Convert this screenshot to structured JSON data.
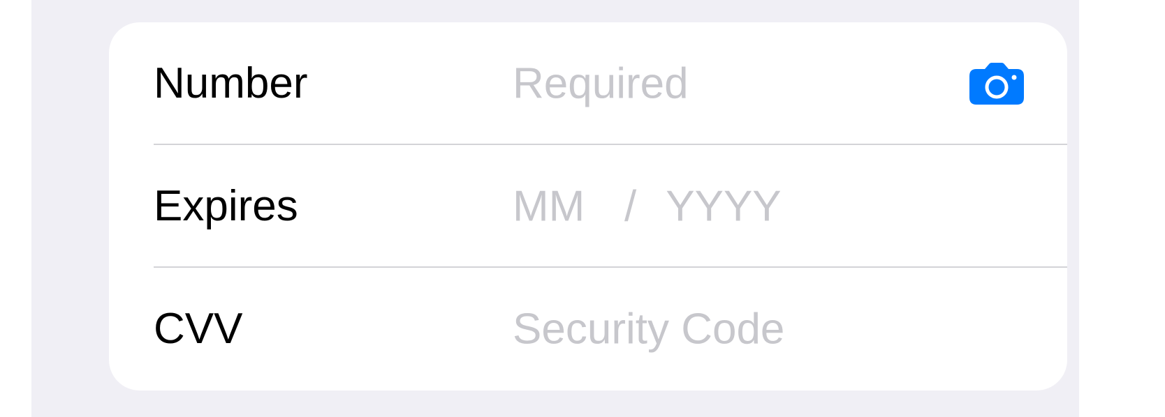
{
  "card_form": {
    "rows": [
      {
        "label": "Number",
        "placeholder": "Required"
      },
      {
        "label": "Expires",
        "month_placeholder": "MM",
        "separator": "/",
        "year_placeholder": "YYYY"
      },
      {
        "label": "CVV",
        "placeholder": "Security Code"
      }
    ],
    "camera_icon": "camera-icon",
    "accent_color": "#007aff",
    "placeholder_color": "#c7c7cc",
    "background_color": "#f0eff5"
  }
}
